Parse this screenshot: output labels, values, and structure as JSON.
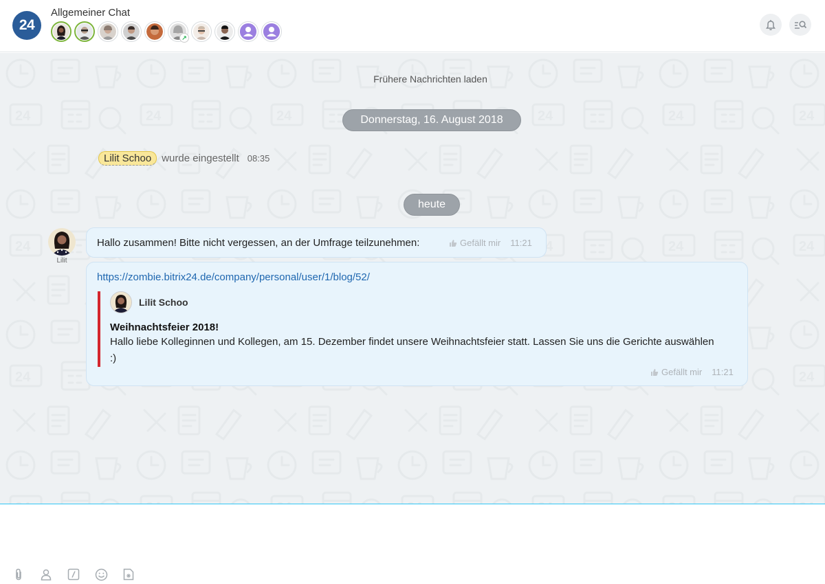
{
  "header": {
    "logo_text": "24",
    "title": "Allgemeiner Chat",
    "members": [
      {
        "name": "member-1",
        "online": true,
        "color": "#3b2c2a"
      },
      {
        "name": "member-2",
        "online": true,
        "color": "#8c8f92"
      },
      {
        "name": "member-3",
        "online": false,
        "color": "#b9aba3"
      },
      {
        "name": "member-4",
        "online": false,
        "color": "#7a6b64"
      },
      {
        "name": "member-5",
        "online": false,
        "color": "#a0603c"
      },
      {
        "name": "member-6",
        "online": false,
        "color": "#c8c8c8"
      },
      {
        "name": "member-7",
        "online": false,
        "color": "#d9c5b8"
      },
      {
        "name": "member-8",
        "online": false,
        "color": "#2a2a2a"
      },
      {
        "name": "member-9",
        "online": false,
        "color": "#9b7fe0"
      },
      {
        "name": "member-10",
        "online": false,
        "color": "#9b7fe0"
      }
    ],
    "colors": {
      "logo": "#2a5c99",
      "online": "#7cb43a"
    }
  },
  "chat": {
    "load_more": "Frühere Nachrichten laden",
    "date_1": "Donnerstag, 16. August 2018",
    "system_message": {
      "name": "Lilit Schoo",
      "text": "wurde eingestellt",
      "time": "08:35"
    },
    "date_2": "heute",
    "author_caption": "Lilit",
    "message_1": {
      "text": "Hallo zusammen! Bitte nicht vergessen, an der Umfrage teilzunehmen:",
      "like": "Gefällt mir",
      "time": "11:21"
    },
    "message_2": {
      "link": "https://zombie.bitrix24.de/company/personal/user/1/blog/52/",
      "quote_author": "Lilit Schoo",
      "quote_title": "Weihnachtsfeier 2018!",
      "quote_body": "Hallo liebe Kolleginnen und Kollegen, am 15. Dezember findet unsere Weihnachtsfeier statt. Lassen Sie uns die Gerichte auswählen  :)",
      "like": "Gefällt mir",
      "time": "11:21"
    },
    "colors": {
      "background": "#eef1f3",
      "bubble_blue": "#e8f4fc",
      "quote_bar": "#d4262e",
      "link": "#1f67b0"
    }
  },
  "input": {
    "toolbar_icons": [
      "paperclip-icon",
      "user-icon",
      "slash-command-icon",
      "smile-icon",
      "sticker-icon"
    ],
    "accent": "#2fc6f6"
  }
}
